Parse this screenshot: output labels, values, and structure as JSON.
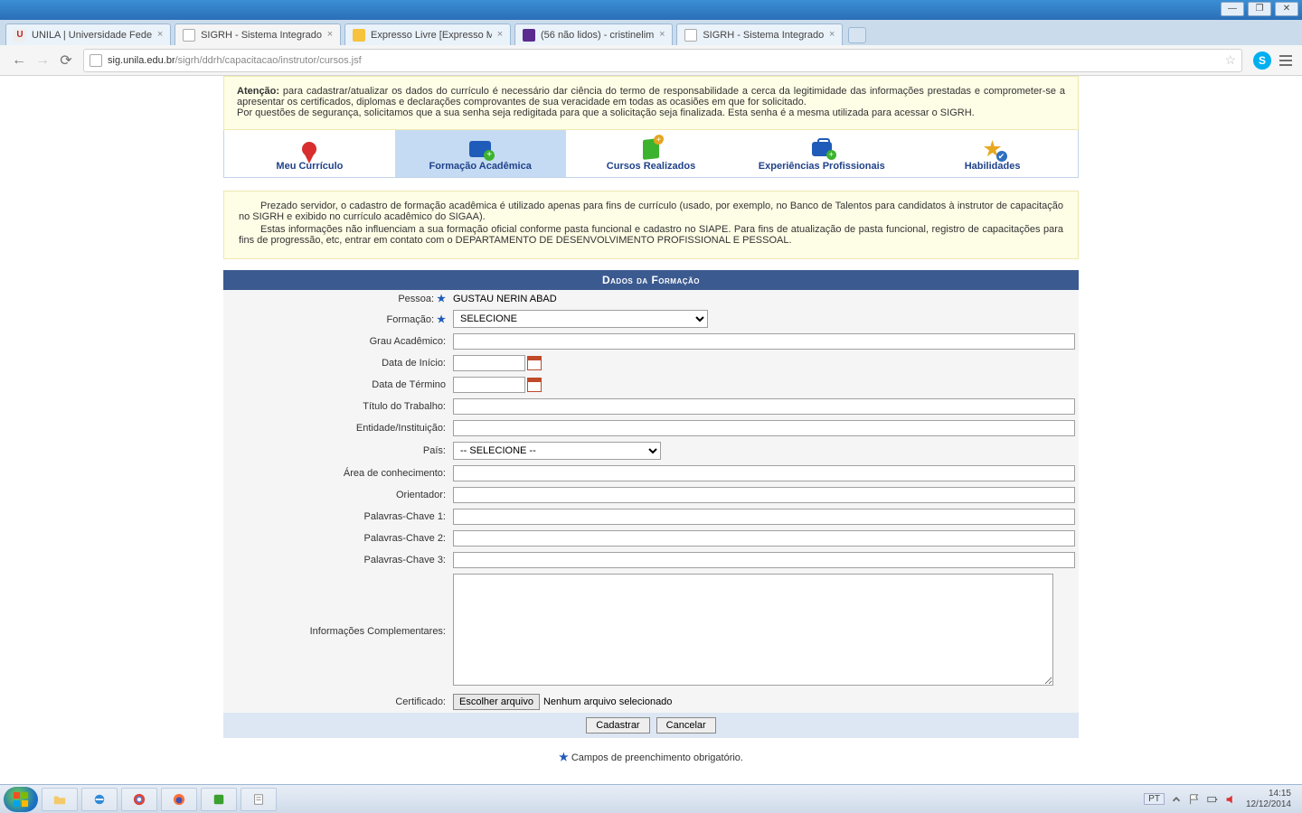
{
  "window": {
    "minimize": "—",
    "maximize": "❐",
    "close": "✕"
  },
  "tabs": [
    {
      "title": "UNILA | Universidade Fede"
    },
    {
      "title": "SIGRH - Sistema Integrado"
    },
    {
      "title": "Expresso Livre [Expresso M"
    },
    {
      "title": "(56 não lidos) - cristinelim"
    },
    {
      "title": "SIGRH - Sistema Integrado"
    }
  ],
  "url": {
    "host": "sig.unila.edu.br",
    "path": "/sigrh/ddrh/capacitacao/instrutor/cursos.jsf"
  },
  "notice": {
    "strong": "Atenção:",
    "l1": " para cadastrar/atualizar os dados do currículo é necessário dar ciência do termo de responsabilidade a cerca da legitimidade das informações prestadas e comprometer-se a apresentar os certificados, diplomas e declarações comprovantes de sua veracidade em todas as ocasiões em que for solicitado.",
    "l2": "Por questões de segurança, solicitamos que a sua senha seja redigitada para que a solicitação seja finalizada. Esta senha é a mesma utilizada para acessar o SIGRH."
  },
  "navTabs": [
    {
      "label": "Meu Currículo"
    },
    {
      "label": "Formação Acadêmica"
    },
    {
      "label": "Cursos Realizados"
    },
    {
      "label": "Experiências Profissionais"
    },
    {
      "label": "Habilidades"
    }
  ],
  "info": {
    "p1": "Prezado servidor, o cadastro de formação acadêmica é utilizado apenas para fins de currículo (usado, por exemplo, no Banco de Talentos para candidatos à instrutor de capacitação no SIGRH e exibido no currículo acadêmico do SIGAA).",
    "p2": "Estas informações não influenciam a sua formação oficial conforme pasta funcional e cadastro no SIAPE. Para fins de atualização de pasta funcional, registro de capacitações para fins de progressão, etc, entrar em contato com o DEPARTAMENTO DE DESENVOLVIMENTO PROFISSIONAL E PESSOAL."
  },
  "formTitle": "Dados da Formação",
  "labels": {
    "pessoa": "Pessoa:",
    "formacao": "Formação:",
    "grau": "Grau Acadêmico:",
    "inicio": "Data de Início:",
    "termino": "Data de Término",
    "titulo": "Título do Trabalho:",
    "entidade": "Entidade/Instituição:",
    "pais": "País:",
    "area": "Área de conhecimento:",
    "orientador": "Orientador:",
    "pc1": "Palavras-Chave 1:",
    "pc2": "Palavras-Chave 2:",
    "pc3": "Palavras-Chave 3:",
    "infoCompl": "Informações Complementares:",
    "cert": "Certificado:"
  },
  "values": {
    "pessoa": "GUSTAU NERIN ABAD",
    "formacaoSel": "SELECIONE",
    "paisSel": "-- SELECIONE --",
    "fileBtn": "Escolher arquivo",
    "fileNone": "Nenhum arquivo selecionado"
  },
  "actions": {
    "cadastrar": "Cadastrar",
    "cancelar": "Cancelar"
  },
  "reqNote": " Campos de preenchimento obrigatório.",
  "tray": {
    "lang": "PT",
    "time": "14:15",
    "date": "12/12/2014"
  }
}
